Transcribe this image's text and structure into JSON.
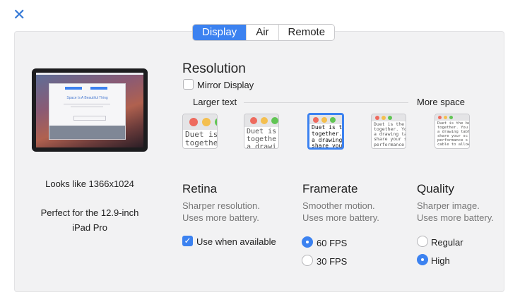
{
  "close_glyph": "✕",
  "tabs": [
    "Display",
    "Air",
    "Remote"
  ],
  "active_tab": "Display",
  "device_preview": {
    "headline": "Space Is A Beautiful Thing"
  },
  "left_info": {
    "looks_like": "Looks like 1366x1024",
    "perfect_for_line1": "Perfect for the 12.9-inch",
    "perfect_for_line2": "iPad Pro"
  },
  "resolution": {
    "title": "Resolution",
    "mirror_label": "Mirror Display",
    "mirror_checked": false,
    "larger_text": "Larger text",
    "more_space": "More space",
    "selected_index": 2,
    "thumbs": [
      {
        "text": "Duet is\ntogethe"
      },
      {
        "text": "Duet is\ntogethe\na drawi"
      },
      {
        "text": "Duet is th\ntogether.\na drawing\nshare your"
      },
      {
        "text": "Duet is the\ntogether. You\na drawing ta\nshare your s\nperformance"
      },
      {
        "text": "Duet is the be\ntogether. You\na drawing tabl\nshare your sc\nperformance s\ncable to allow"
      }
    ]
  },
  "retina": {
    "title": "Retina",
    "desc_line1": "Sharper resolution.",
    "desc_line2": "Uses more battery.",
    "checkbox_label": "Use when available",
    "checked": true
  },
  "framerate": {
    "title": "Framerate",
    "desc_line1": "Smoother motion.",
    "desc_line2": "Uses more battery.",
    "options": [
      "60 FPS",
      "30 FPS"
    ],
    "selected": "60 FPS"
  },
  "quality": {
    "title": "Quality",
    "desc_line1": "Sharper image.",
    "desc_line2": "Uses more battery.",
    "options": [
      "Regular",
      "High"
    ],
    "selected": "High"
  },
  "colors": {
    "accent": "#3c82f0",
    "panel": "#f2f2f3",
    "traffic_red": "#ee6a5e",
    "traffic_yellow": "#f4bf4f",
    "traffic_green": "#61c554"
  }
}
